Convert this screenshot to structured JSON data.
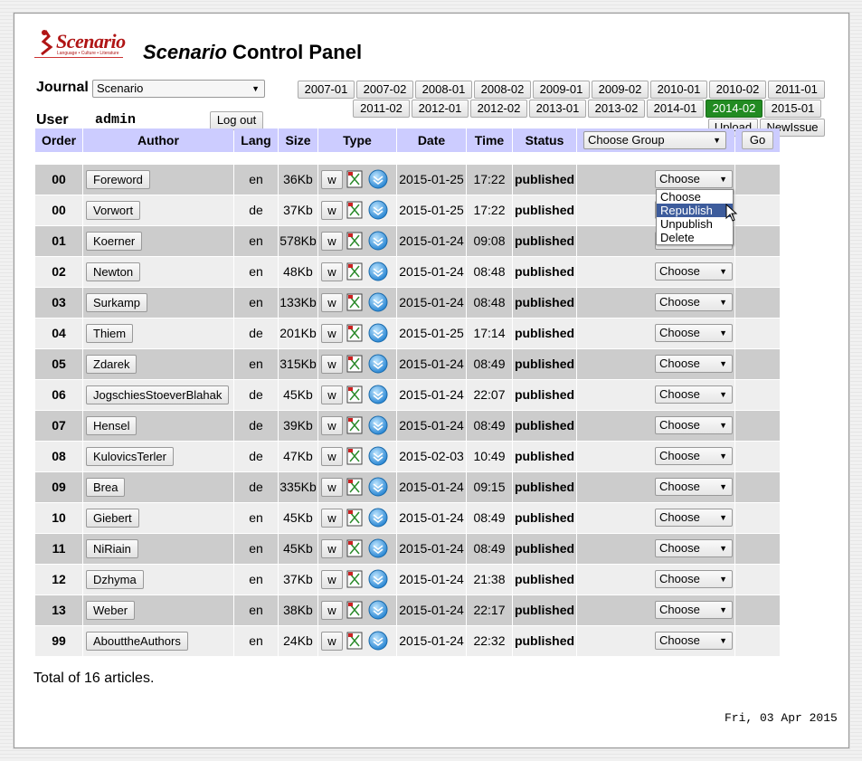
{
  "header": {
    "logo_text": "Scenario",
    "logo_tagline": "Language • Culture • Literature",
    "title_italic": "Scenario",
    "title_rest": " Control Panel"
  },
  "journal": {
    "label": "Journal",
    "selected": "Scenario"
  },
  "user": {
    "label": "User",
    "value": "admin",
    "logout_label": "Log out"
  },
  "issues": {
    "row1": [
      "2007-01",
      "2007-02",
      "2008-01",
      "2008-02",
      "2009-01",
      "2009-02",
      "2010-01",
      "2010-02",
      "2011-01"
    ],
    "row2": [
      "2011-02",
      "2012-01",
      "2012-02",
      "2013-01",
      "2013-02",
      "2014-01",
      "2014-02",
      "2015-01"
    ],
    "active": "2014-02",
    "upload_label": "Upload",
    "newissue_label": "NewIssue"
  },
  "table": {
    "headers": {
      "order": "Order",
      "author": "Author",
      "lang": "Lang",
      "size": "Size",
      "type": "Type",
      "date": "Date",
      "time": "Time",
      "status": "Status"
    },
    "group_select": "Choose Group",
    "go_label": "Go",
    "w_label": "w",
    "choose_label": "Choose",
    "rows": [
      {
        "order": "00",
        "author": "Foreword",
        "lang": "en",
        "size": "36Kb",
        "date": "2015-01-25",
        "time": "17:22",
        "status": "published"
      },
      {
        "order": "00",
        "author": "Vorwort",
        "lang": "de",
        "size": "37Kb",
        "date": "2015-01-25",
        "time": "17:22",
        "status": "published"
      },
      {
        "order": "01",
        "author": "Koerner",
        "lang": "en",
        "size": "578Kb",
        "date": "2015-01-24",
        "time": "09:08",
        "status": "published"
      },
      {
        "order": "02",
        "author": "Newton",
        "lang": "en",
        "size": "48Kb",
        "date": "2015-01-24",
        "time": "08:48",
        "status": "published"
      },
      {
        "order": "03",
        "author": "Surkamp",
        "lang": "en",
        "size": "133Kb",
        "date": "2015-01-24",
        "time": "08:48",
        "status": "published"
      },
      {
        "order": "04",
        "author": "Thiem",
        "lang": "de",
        "size": "201Kb",
        "date": "2015-01-25",
        "time": "17:14",
        "status": "published"
      },
      {
        "order": "05",
        "author": "Zdarek",
        "lang": "en",
        "size": "315Kb",
        "date": "2015-01-24",
        "time": "08:49",
        "status": "published"
      },
      {
        "order": "06",
        "author": "JogschiesStoeverBlahak",
        "lang": "de",
        "size": "45Kb",
        "date": "2015-01-24",
        "time": "22:07",
        "status": "published"
      },
      {
        "order": "07",
        "author": "Hensel",
        "lang": "de",
        "size": "39Kb",
        "date": "2015-01-24",
        "time": "08:49",
        "status": "published"
      },
      {
        "order": "08",
        "author": "KulovicsTerler",
        "lang": "de",
        "size": "47Kb",
        "date": "2015-02-03",
        "time": "10:49",
        "status": "published"
      },
      {
        "order": "09",
        "author": "Brea",
        "lang": "de",
        "size": "335Kb",
        "date": "2015-01-24",
        "time": "09:15",
        "status": "published"
      },
      {
        "order": "10",
        "author": "Giebert",
        "lang": "en",
        "size": "45Kb",
        "date": "2015-01-24",
        "time": "08:49",
        "status": "published"
      },
      {
        "order": "11",
        "author": "NiRiain",
        "lang": "en",
        "size": "45Kb",
        "date": "2015-01-24",
        "time": "08:49",
        "status": "published"
      },
      {
        "order": "12",
        "author": "Dzhyma",
        "lang": "en",
        "size": "37Kb",
        "date": "2015-01-24",
        "time": "21:38",
        "status": "published"
      },
      {
        "order": "13",
        "author": "Weber",
        "lang": "en",
        "size": "38Kb",
        "date": "2015-01-24",
        "time": "22:17",
        "status": "published"
      },
      {
        "order": "99",
        "author": "AbouttheAuthors",
        "lang": "en",
        "size": "24Kb",
        "date": "2015-01-24",
        "time": "22:32",
        "status": "published"
      }
    ]
  },
  "dropdown_menu": {
    "options": [
      "Choose",
      "Republish",
      "Unpublish",
      "Delete"
    ],
    "highlighted": "Republish"
  },
  "footer": {
    "total": "Total of 16 articles.",
    "date": "Fri, 03 Apr 2015"
  },
  "icons": {
    "pdf": "pdf-icon",
    "download": "download-icon",
    "cursor": "mouse-pointer-icon"
  },
  "colors": {
    "header_bg": "#ccccff",
    "active_issue": "#228b22",
    "row_dark": "#cccccc",
    "row_light": "#eeeeee",
    "dropdown_highlight": "#3d5c9c"
  }
}
